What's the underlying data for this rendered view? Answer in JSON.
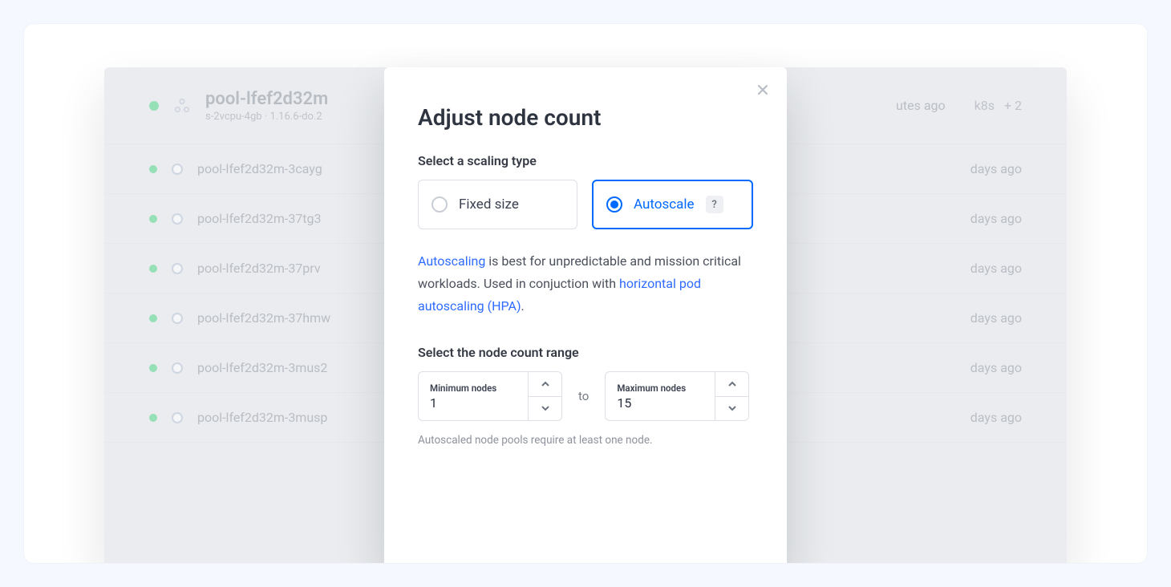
{
  "background": {
    "pool": {
      "name": "pool-lfef2d32m",
      "spec": "s-2vcpu-4gb · 1.16.6-do.2",
      "age_text": "utes ago",
      "tag": "k8s",
      "more_text": "+ 2"
    },
    "nodes": [
      {
        "name": "pool-lfef2d32m-3cayg",
        "age_text": "days ago"
      },
      {
        "name": "pool-lfef2d32m-37tg3",
        "age_text": "days ago"
      },
      {
        "name": "pool-lfef2d32m-37prv",
        "age_text": "days ago"
      },
      {
        "name": "pool-lfef2d32m-37hmw",
        "age_text": "days ago"
      },
      {
        "name": "pool-lfef2d32m-3mus2",
        "age_text": "days ago"
      },
      {
        "name": "pool-lfef2d32m-3musp",
        "age_text": "days ago"
      }
    ]
  },
  "modal": {
    "title": "Adjust node count",
    "scaling_label": "Select a scaling type",
    "fixed_label": "Fixed size",
    "autoscale_label": "Autoscale",
    "help_mark": "?",
    "desc_link1": "Autoscaling",
    "desc_text1": " is best for unpredictable and mission critical workloads. Used in conjuction with ",
    "desc_link2": "horizontal pod autoscaling (HPA)",
    "desc_tail": ".",
    "range_label": "Select the node count range",
    "min_label": "Minimum nodes",
    "min_value": "1",
    "to_text": "to",
    "max_label": "Maximum nodes",
    "max_value": "15",
    "hint": "Autoscaled node pools require at least one node."
  }
}
